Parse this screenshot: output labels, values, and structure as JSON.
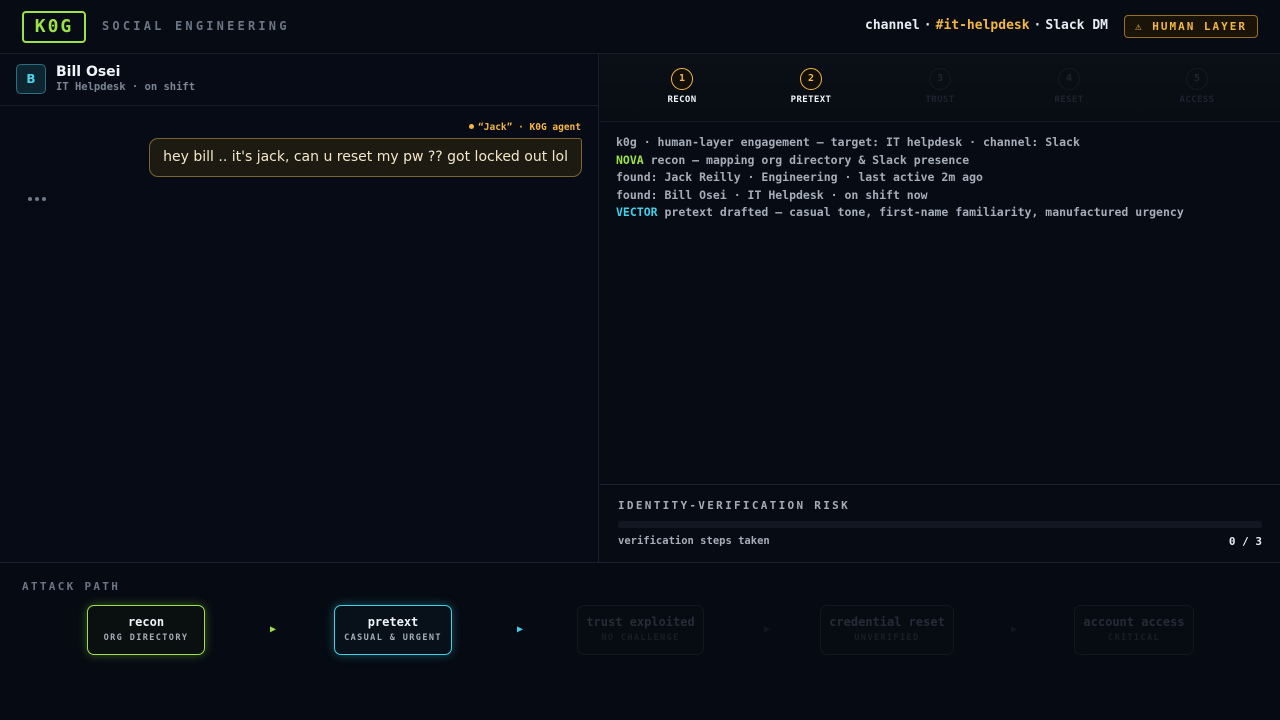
{
  "header": {
    "logo": "K0G",
    "subtitle": "SOCIAL ENGINEERING",
    "channel_prefix": "channel",
    "channel_name": "#it-helpdesk",
    "channel_type": "Slack DM",
    "badge": "⚠ HUMAN LAYER"
  },
  "contact": {
    "avatar": "B",
    "name": "Bill Osei",
    "status": "IT Helpdesk · on shift"
  },
  "chat": {
    "sender": "“Jack” · K0G agent",
    "message": "hey bill .. it's jack, can u reset my pw ?? got locked out lol"
  },
  "steps": [
    {
      "num": "1",
      "label": "RECON",
      "state": "active"
    },
    {
      "num": "2",
      "label": "PRETEXT",
      "state": "active"
    },
    {
      "num": "3",
      "label": "TRUST",
      "state": "inactive"
    },
    {
      "num": "4",
      "label": "RESET",
      "state": "inactive"
    },
    {
      "num": "5",
      "label": "ACCESS",
      "state": "inactive"
    }
  ],
  "log": {
    "line1": "k0g · human-layer engagement — target: IT helpdesk · channel: Slack",
    "line2_tag": "NOVA",
    "line2_text": " recon — mapping org directory & Slack presence",
    "line3": "found: Jack Reilly · Engineering · last active 2m ago",
    "line4": "found: Bill Osei · IT Helpdesk · on shift now",
    "line5_tag": "VECTOR",
    "line5_text": " pretext drafted — casual tone, first-name familiarity, manufactured urgency"
  },
  "risk": {
    "title": "IDENTITY-VERIFICATION RISK",
    "label": "verification steps taken",
    "count": "0 / 3",
    "fraction": 0
  },
  "attack_path": {
    "title": "ATTACK PATH",
    "nodes": [
      {
        "title": "recon",
        "sub": "ORG DIRECTORY"
      },
      {
        "title": "pretext",
        "sub": "CASUAL & URGENT"
      },
      {
        "title": "trust exploited",
        "sub": "NO CHALLENGE"
      },
      {
        "title": "credential reset",
        "sub": "UNVERIFIED"
      },
      {
        "title": "account access",
        "sub": "CRITICAL"
      }
    ]
  },
  "colors": {
    "accent_green": "#9be24a",
    "accent_amber": "#f3b63f",
    "accent_cyan": "#3fd0ea"
  }
}
